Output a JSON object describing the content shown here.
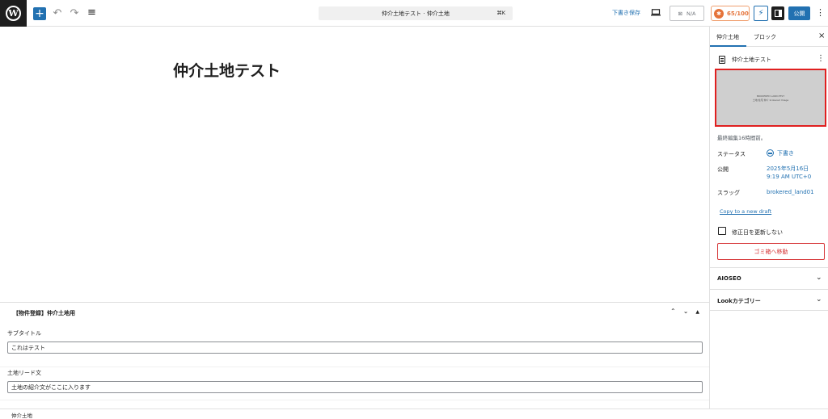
{
  "topbar": {
    "logo_letter": "W",
    "add_symbol": "+",
    "undo_symbol": "↶",
    "redo_symbol": "↷",
    "list_symbol": "≡",
    "doc_title": "仲介土地テスト · 仲介土地",
    "shortcut": "⌘K",
    "save_draft": "下書き保存",
    "seo_na": "N/A",
    "seo_score": "65/100",
    "publish": "公開",
    "more_symbol": "⋮"
  },
  "editor": {
    "title": "仲介土地テスト"
  },
  "metabox": {
    "title": "【物件登録】仲介土地用",
    "fields": [
      {
        "label": "サブタイトル",
        "value": "これはテスト"
      },
      {
        "label": "土地リード文",
        "value": "土地の紹介文がここに入ります"
      }
    ]
  },
  "footer": {
    "breadcrumb": "仲介土地"
  },
  "sidebar": {
    "tabs": [
      "仲介土地",
      "ブロック"
    ],
    "close_symbol": "×",
    "doc_title": "仲介土地テスト",
    "thumbnail_lines": [
      "BROKERED LAND-TEST",
      "土地/住宅 仲介 brokered Image"
    ],
    "last_edited": "最終編集16時間前。",
    "rows": {
      "status_label": "ステータス",
      "status_value": "下書き",
      "publish_label": "公開",
      "publish_date": "2025年5月16日",
      "publish_time": "9:19 AM UTC+0",
      "slug_label": "スラッグ",
      "slug_value": "brokered_land01"
    },
    "copy_draft": "Copy to a new draft",
    "no_update_label": "修正日を更新しない",
    "trash": "ゴミ箱へ移動",
    "panels": [
      "AIOSEO",
      "Lookカテゴリー"
    ],
    "chevron_symbol": "⌄"
  }
}
